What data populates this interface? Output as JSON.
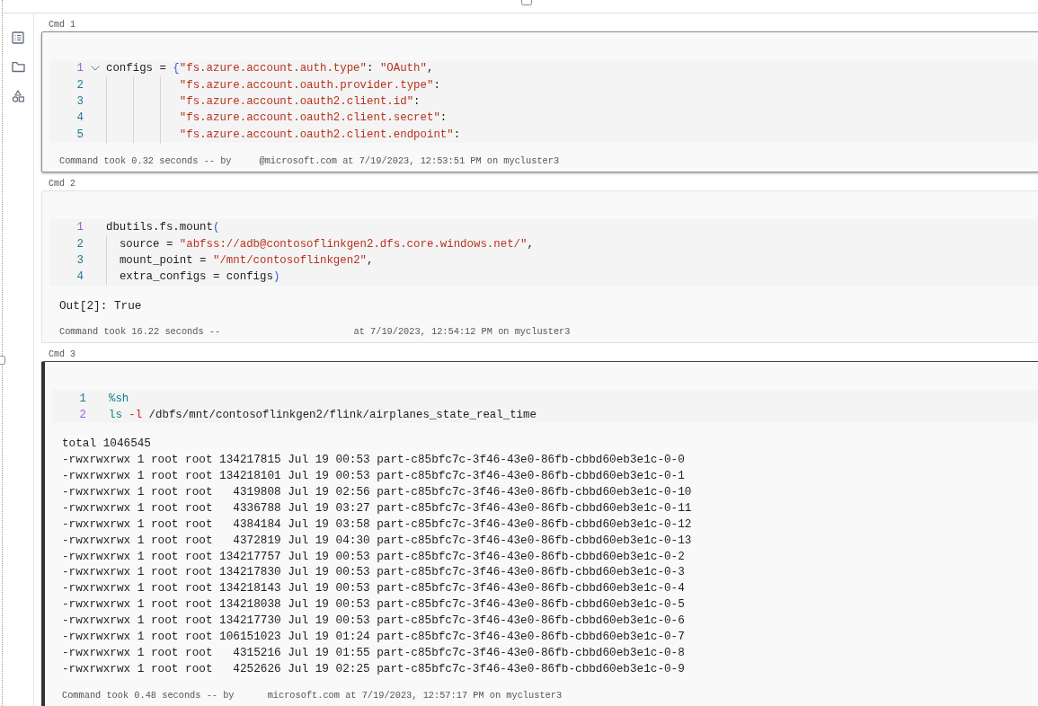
{
  "sidebar": {
    "items": [
      {
        "kind": "list"
      },
      {
        "kind": "folder"
      },
      {
        "kind": "shapes"
      }
    ]
  },
  "cells": [
    {
      "label": "Cmd 1",
      "selected": false,
      "hovered": true,
      "lines": [
        {
          "number": "1",
          "current": true,
          "foldable": true,
          "kind": "top",
          "segments": [
            {
              "kind": "plain",
              "text": "configs = "
            },
            {
              "kind": "bracket",
              "text": "{"
            },
            {
              "kind": "string",
              "text": "\"fs.azure.account.auth.type\""
            },
            {
              "kind": "plain",
              "text": ": "
            },
            {
              "kind": "string",
              "text": "\"OAuth\""
            },
            {
              "kind": "plain",
              "text": ","
            }
          ]
        },
        {
          "number": "2",
          "current": false,
          "kind": "aligned",
          "segments": [
            {
              "kind": "string",
              "text": "\"fs.azure.account.oauth.provider.type\""
            },
            {
              "kind": "plain",
              "text": ":"
            }
          ]
        },
        {
          "number": "3",
          "current": false,
          "kind": "aligned",
          "segments": [
            {
              "kind": "string",
              "text": "\"fs.azure.account.oauth2.client.id\""
            },
            {
              "kind": "plain",
              "text": ":"
            }
          ]
        },
        {
          "number": "4",
          "current": false,
          "kind": "aligned",
          "segments": [
            {
              "kind": "string",
              "text": "\"fs.azure.account.oauth2.client.secret\""
            },
            {
              "kind": "plain",
              "text": ":"
            }
          ]
        },
        {
          "number": "5",
          "current": false,
          "kind": "aligned",
          "segments": [
            {
              "kind": "string",
              "text": "\"fs.azure.account.oauth2.client.endpoint\""
            },
            {
              "kind": "plain",
              "text": ":"
            }
          ]
        }
      ],
      "footer": "Command took 0.32 seconds -- by     @microsoft.com at 7/19/2023, 12:53:51 PM on mycluster3"
    },
    {
      "label": "Cmd 2",
      "selected": false,
      "hovered": false,
      "lines": [
        {
          "number": "1",
          "current": true,
          "kind": "top",
          "segments": [
            {
              "kind": "plain",
              "text": "dbutils.fs.mount"
            },
            {
              "kind": "bracket",
              "text": "("
            }
          ]
        },
        {
          "number": "2",
          "current": false,
          "kind": "nested",
          "segments": [
            {
              "kind": "plain",
              "text": "source = "
            },
            {
              "kind": "string",
              "text": "\"abfss://adb@contosoflinkgen2.dfs.core.windows.net/\""
            },
            {
              "kind": "plain",
              "text": ","
            }
          ]
        },
        {
          "number": "3",
          "current": false,
          "kind": "nested",
          "segments": [
            {
              "kind": "plain",
              "text": "mount_point = "
            },
            {
              "kind": "string",
              "text": "\"/mnt/contosoflinkgen2\""
            },
            {
              "kind": "plain",
              "text": ","
            }
          ]
        },
        {
          "number": "4",
          "current": false,
          "kind": "nested",
          "segments": [
            {
              "kind": "plain",
              "text": "extra_configs = configs"
            },
            {
              "kind": "bracket",
              "text": ")"
            }
          ]
        }
      ],
      "output": [
        "Out[2]: True"
      ],
      "footer": "Command took 16.22 seconds --                        at 7/19/2023, 12:54:12 PM on mycluster3"
    },
    {
      "label": "Cmd 3",
      "selected": true,
      "hovered": false,
      "lines": [
        {
          "number": "1",
          "current": false,
          "kind": "top",
          "segments": [
            {
              "kind": "command",
              "text": "%sh"
            }
          ]
        },
        {
          "number": "2",
          "current": true,
          "kind": "top",
          "segments": [
            {
              "kind": "command",
              "text": "ls"
            },
            {
              "kind": "flag",
              "text": " -l"
            },
            {
              "kind": "plain",
              "text": " /dbfs/mnt/contosoflinkgen2/flink/airplanes_state_real_time"
            }
          ]
        }
      ],
      "output": [
        "total 1046545",
        "-rwxrwxrwx 1 root root 134217815 Jul 19 00:53 part-c85bfc7c-3f46-43e0-86fb-cbbd60eb3e1c-0-0",
        "-rwxrwxrwx 1 root root 134218101 Jul 19 00:53 part-c85bfc7c-3f46-43e0-86fb-cbbd60eb3e1c-0-1",
        "-rwxrwxrwx 1 root root   4319808 Jul 19 02:56 part-c85bfc7c-3f46-43e0-86fb-cbbd60eb3e1c-0-10",
        "-rwxrwxrwx 1 root root   4336788 Jul 19 03:27 part-c85bfc7c-3f46-43e0-86fb-cbbd60eb3e1c-0-11",
        "-rwxrwxrwx 1 root root   4384184 Jul 19 03:58 part-c85bfc7c-3f46-43e0-86fb-cbbd60eb3e1c-0-12",
        "-rwxrwxrwx 1 root root   4372819 Jul 19 04:30 part-c85bfc7c-3f46-43e0-86fb-cbbd60eb3e1c-0-13",
        "-rwxrwxrwx 1 root root 134217757 Jul 19 00:53 part-c85bfc7c-3f46-43e0-86fb-cbbd60eb3e1c-0-2",
        "-rwxrwxrwx 1 root root 134217830 Jul 19 00:53 part-c85bfc7c-3f46-43e0-86fb-cbbd60eb3e1c-0-3",
        "-rwxrwxrwx 1 root root 134218143 Jul 19 00:53 part-c85bfc7c-3f46-43e0-86fb-cbbd60eb3e1c-0-4",
        "-rwxrwxrwx 1 root root 134218038 Jul 19 00:53 part-c85bfc7c-3f46-43e0-86fb-cbbd60eb3e1c-0-5",
        "-rwxrwxrwx 1 root root 134217730 Jul 19 00:53 part-c85bfc7c-3f46-43e0-86fb-cbbd60eb3e1c-0-6",
        "-rwxrwxrwx 1 root root 106151023 Jul 19 01:24 part-c85bfc7c-3f46-43e0-86fb-cbbd60eb3e1c-0-7",
        "-rwxrwxrwx 1 root root   4315216 Jul 19 01:55 part-c85bfc7c-3f46-43e0-86fb-cbbd60eb3e1c-0-8",
        "-rwxrwxrwx 1 root root   4252626 Jul 19 02:25 part-c85bfc7c-3f46-43e0-86fb-cbbd60eb3e1c-0-9"
      ],
      "footer": "Command took 0.48 seconds -- by      microsoft.com at 7/19/2023, 12:57:17 PM on mycluster3"
    }
  ]
}
